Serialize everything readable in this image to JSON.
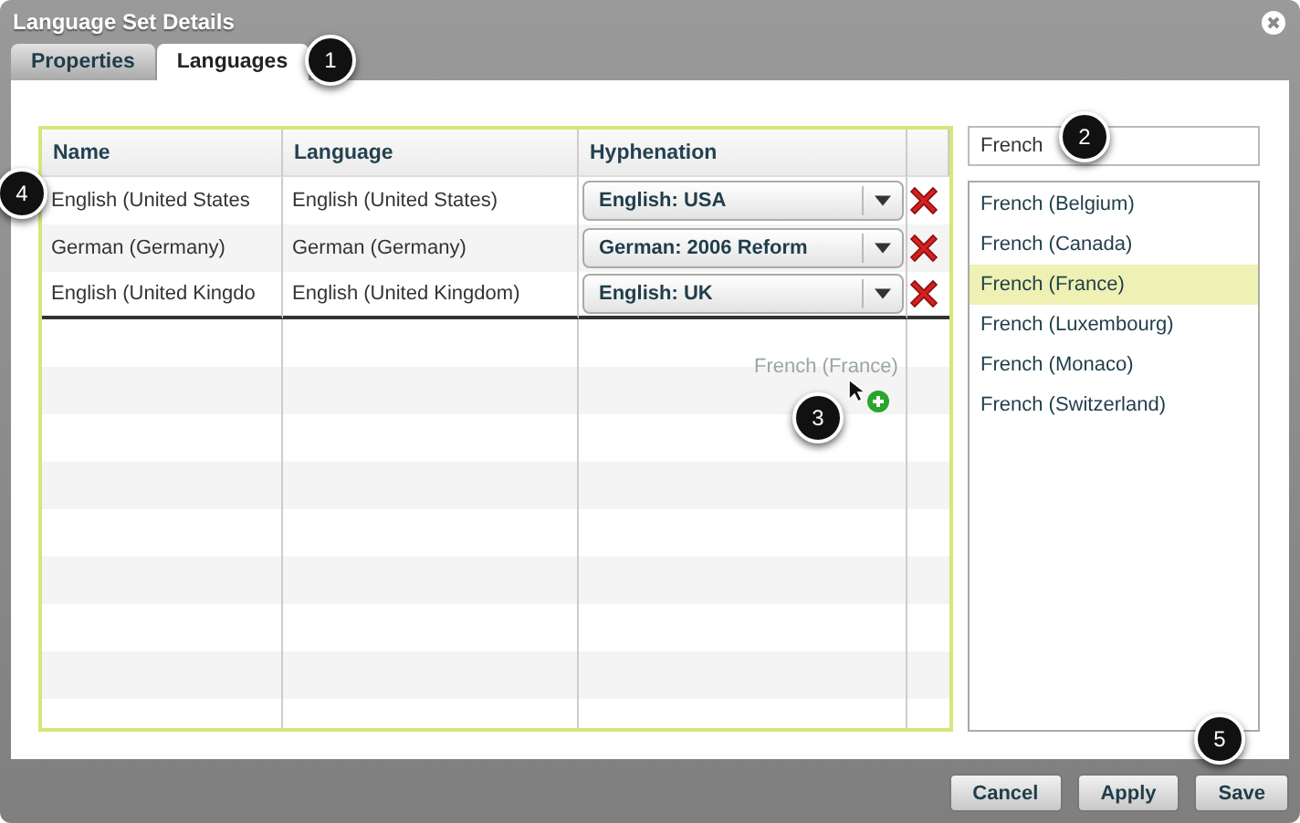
{
  "window": {
    "title": "Language Set Details"
  },
  "tabs": [
    {
      "label": "Properties",
      "selected": false
    },
    {
      "label": "Languages",
      "selected": true
    }
  ],
  "table": {
    "columns": [
      "Name",
      "Language",
      "Hyphenation"
    ],
    "rows": [
      {
        "name": "English (United States",
        "language": "English (United States)",
        "hyphenation": "English: USA"
      },
      {
        "name": "German (Germany)",
        "language": "German (Germany)",
        "hyphenation": "German: 2006 Reform"
      },
      {
        "name": "English (United Kingdo",
        "language": "English (United Kingdom)",
        "hyphenation": "English: UK"
      }
    ]
  },
  "drag_preview": {
    "label": "French (France)"
  },
  "search": {
    "value": "French"
  },
  "language_list": [
    {
      "label": "French (Belgium)",
      "selected": false
    },
    {
      "label": "French (Canada)",
      "selected": false
    },
    {
      "label": "French (France)",
      "selected": true
    },
    {
      "label": "French (Luxembourg)",
      "selected": false
    },
    {
      "label": "French (Monaco)",
      "selected": false
    },
    {
      "label": "French (Switzerland)",
      "selected": false
    }
  ],
  "callouts": [
    "1",
    "2",
    "3",
    "4",
    "5"
  ],
  "buttons": [
    "Cancel",
    "Apply",
    "Save"
  ]
}
